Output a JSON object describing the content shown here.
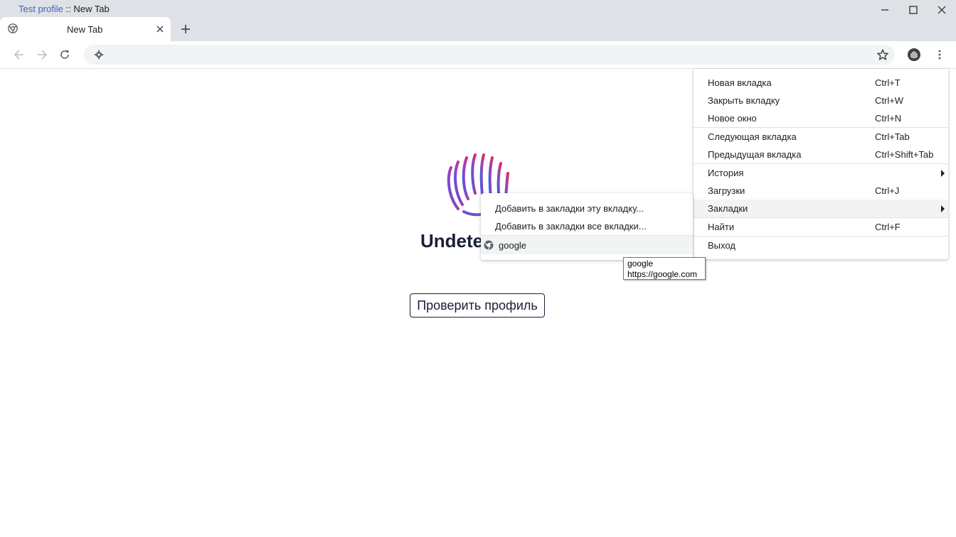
{
  "window": {
    "profile_name": "Test profile",
    "separator": " :: ",
    "title": "New Tab"
  },
  "tab": {
    "title": "New Tab"
  },
  "omnibox": {
    "value": ""
  },
  "page": {
    "heading": "Undete",
    "check_button": "Проверить профиль"
  },
  "menu": {
    "items": [
      {
        "label": "Новая вкладка",
        "shortcut": "Ctrl+T"
      },
      {
        "label": "Закрыть вкладку",
        "shortcut": "Ctrl+W"
      },
      {
        "label": "Новое окно",
        "shortcut": "Ctrl+N"
      },
      {
        "label": "Следующая вкладка",
        "shortcut": "Ctrl+Tab"
      },
      {
        "label": "Предыдущая вкладка",
        "shortcut": "Ctrl+Shift+Tab"
      },
      {
        "label": "История",
        "shortcut": ""
      },
      {
        "label": "Загрузки",
        "shortcut": "Ctrl+J"
      },
      {
        "label": "Закладки",
        "shortcut": ""
      },
      {
        "label": "Найти",
        "shortcut": "Ctrl+F"
      },
      {
        "label": "Выход",
        "shortcut": ""
      }
    ]
  },
  "bookmarks_submenu": {
    "items": [
      {
        "label": "Добавить в закладки эту вкладку..."
      },
      {
        "label": "Добавить в закладки все вкладки..."
      },
      {
        "label": "google"
      }
    ]
  },
  "tooltip": {
    "title": "google",
    "url": "https://google.com"
  },
  "colors": {
    "tab_strip": "#dee1e6",
    "profile_link": "#4461c4",
    "heading": "#1a1f36",
    "hover": "#f1f3f4"
  }
}
